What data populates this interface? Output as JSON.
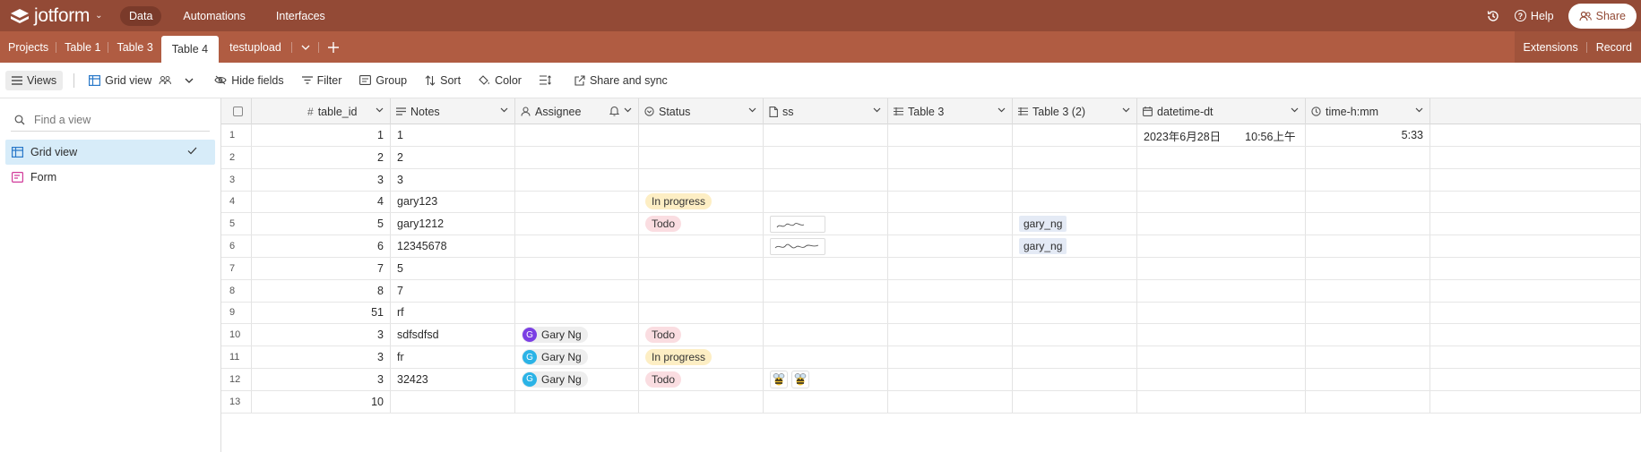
{
  "app": {
    "logo_text": "jotform"
  },
  "nav": {
    "items": [
      "Data",
      "Automations",
      "Interfaces"
    ],
    "active": "Data"
  },
  "topright": {
    "help_label": "Help",
    "share_label": "Share"
  },
  "tabs": {
    "items": [
      "Projects",
      "Table 1",
      "Table 3",
      "Table 4",
      "testupload"
    ],
    "active": "Table 4",
    "right": [
      "Extensions",
      "Record"
    ]
  },
  "toolbar": {
    "views_label": "Views",
    "grid_view_label": "Grid view",
    "hide_fields_label": "Hide fields",
    "filter_label": "Filter",
    "group_label": "Group",
    "sort_label": "Sort",
    "color_label": "Color",
    "share_sync_label": "Share and sync"
  },
  "sidebar": {
    "find_placeholder": "Find a view",
    "views": [
      {
        "label": "Grid view",
        "active": true
      },
      {
        "label": "Form",
        "active": false
      }
    ]
  },
  "columns": [
    "table_id",
    "Notes",
    "Assignee",
    "Status",
    "ss",
    "Table 3",
    "Table 3 (2)",
    "datetime-dt",
    "time-h:mm"
  ],
  "rows": [
    {
      "n": "1",
      "table_id": "1",
      "notes": "1",
      "assignee": "",
      "status": "",
      "ss": "",
      "t3": "",
      "t32": "",
      "date": "2023年6月28日",
      "dtime": "10:56上午",
      "time": "5:33"
    },
    {
      "n": "2",
      "table_id": "2",
      "notes": "2",
      "assignee": "",
      "status": "",
      "ss": "",
      "t3": "",
      "t32": "",
      "date": "",
      "dtime": "",
      "time": ""
    },
    {
      "n": "3",
      "table_id": "3",
      "notes": "3",
      "assignee": "",
      "status": "",
      "ss": "",
      "t3": "",
      "t32": "",
      "date": "",
      "dtime": "",
      "time": ""
    },
    {
      "n": "4",
      "table_id": "4",
      "notes": "gary123",
      "assignee": "",
      "status": "In progress",
      "ss": "",
      "t3": "",
      "t32": "",
      "date": "",
      "dtime": "",
      "time": ""
    },
    {
      "n": "5",
      "table_id": "5",
      "notes": "gary1212",
      "assignee": "",
      "status": "Todo",
      "ss": "signature",
      "t3": "",
      "t32": "gary_ng",
      "date": "",
      "dtime": "",
      "time": ""
    },
    {
      "n": "6",
      "table_id": "6",
      "notes": "12345678",
      "assignee": "",
      "status": "",
      "ss": "signature",
      "t3": "",
      "t32": "gary_ng",
      "date": "",
      "dtime": "",
      "time": ""
    },
    {
      "n": "7",
      "table_id": "7",
      "notes": "5",
      "assignee": "",
      "status": "",
      "ss": "",
      "t3": "",
      "t32": "",
      "date": "",
      "dtime": "",
      "time": ""
    },
    {
      "n": "8",
      "table_id": "8",
      "notes": "7",
      "assignee": "",
      "status": "",
      "ss": "",
      "t3": "",
      "t32": "",
      "date": "",
      "dtime": "",
      "time": ""
    },
    {
      "n": "9",
      "table_id": "51",
      "notes": "rf",
      "assignee": "",
      "status": "",
      "ss": "",
      "t3": "",
      "t32": "",
      "date": "",
      "dtime": "",
      "time": ""
    },
    {
      "n": "10",
      "table_id": "3",
      "notes": "sdfsdfsd",
      "assignee": "Gary Ng",
      "avatar_color": "#7b3fe4",
      "status": "Todo",
      "ss": "",
      "t3": "",
      "t32": "",
      "date": "",
      "dtime": "",
      "time": ""
    },
    {
      "n": "11",
      "table_id": "3",
      "notes": "fr",
      "assignee": "Gary Ng",
      "avatar_color": "#2bb3e6",
      "status": "In progress",
      "ss": "",
      "t3": "",
      "t32": "",
      "date": "",
      "dtime": "",
      "time": ""
    },
    {
      "n": "12",
      "table_id": "3",
      "notes": "32423",
      "assignee": "Gary Ng",
      "avatar_color": "#2bb3e6",
      "status": "Todo",
      "ss": "bees",
      "t3": "",
      "t32": "",
      "date": "",
      "dtime": "",
      "time": ""
    },
    {
      "n": "13",
      "table_id": "10",
      "notes": "",
      "assignee": "",
      "status": "",
      "ss": "",
      "t3": "",
      "t32": "",
      "date": "",
      "dtime": "",
      "time": ""
    }
  ],
  "avatar_initial": "G",
  "colors": {
    "topbar": "#934a36",
    "tabbar": "#b05c42",
    "todo": "#fadde1",
    "in_progress": "#fdeec4",
    "link": "#e4eaf5",
    "active_view": "#d7ecf9"
  }
}
